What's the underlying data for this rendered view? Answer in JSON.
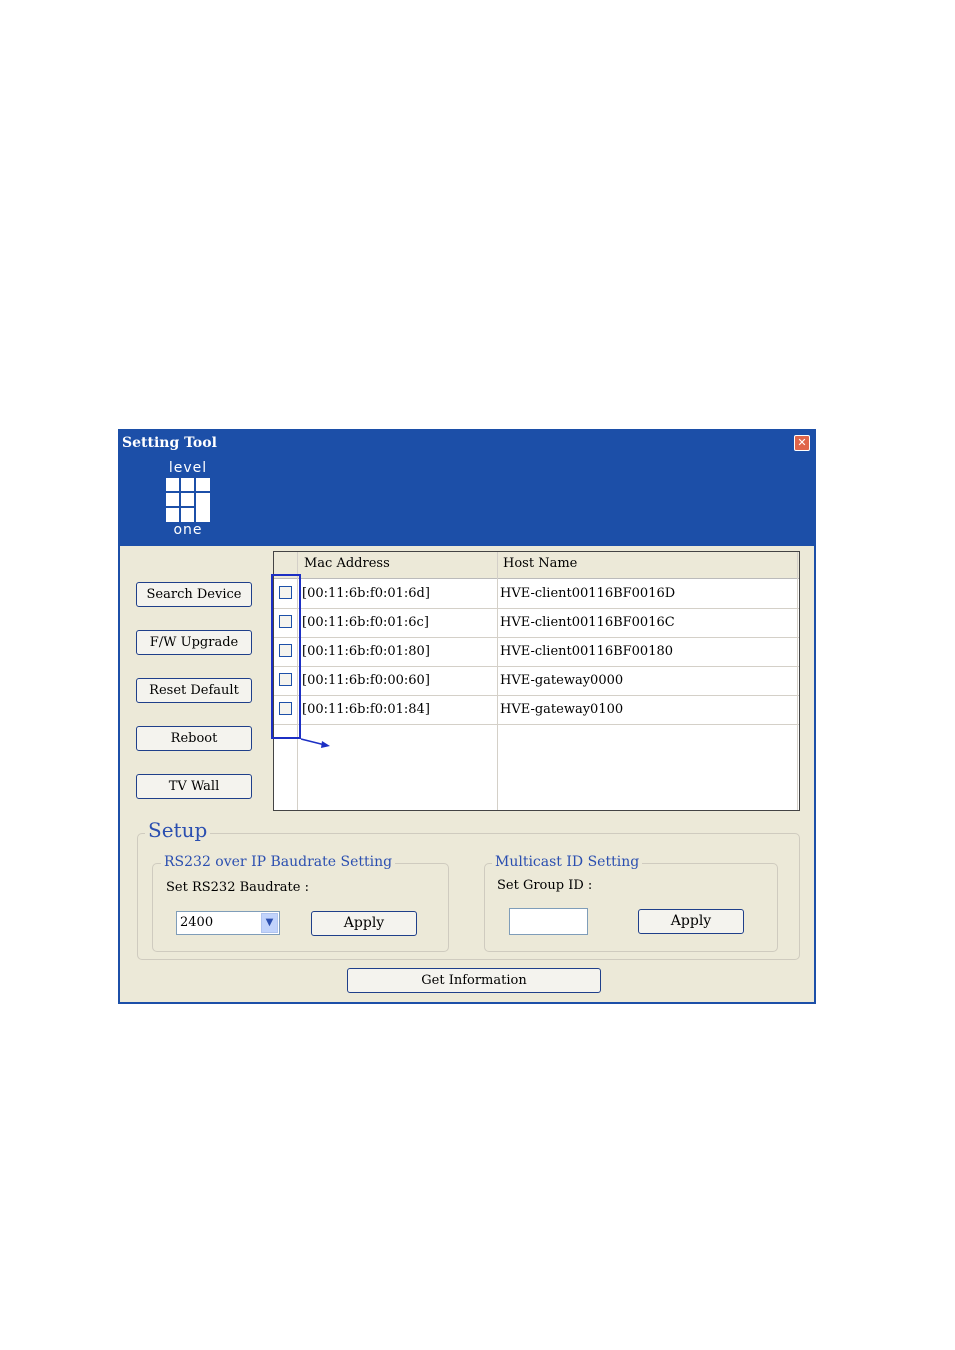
{
  "window": {
    "title": "Setting Tool",
    "close_glyph": "✕"
  },
  "logo": {
    "top_text": "level",
    "bottom_text": "one"
  },
  "buttons": {
    "search_device": "Search Device",
    "fw_upgrade": "F/W Upgrade",
    "reset_default": "Reset Default",
    "reboot": "Reboot",
    "tv_wall": "TV Wall",
    "get_information": "Get Information"
  },
  "device_list": {
    "columns": [
      "Mac Address",
      "Host Name"
    ],
    "rows": [
      {
        "mac": "[00:11:6b:f0:01:6d]",
        "host": "HVE-client00116BF0016D",
        "checked": false
      },
      {
        "mac": "[00:11:6b:f0:01:6c]",
        "host": "HVE-client00116BF0016C",
        "checked": false
      },
      {
        "mac": "[00:11:6b:f0:01:80]",
        "host": "HVE-client00116BF00180",
        "checked": false
      },
      {
        "mac": "[00:11:6b:f0:00:60]",
        "host": "HVE-gateway0000",
        "checked": false
      },
      {
        "mac": "[00:11:6b:f0:01:84]",
        "host": "HVE-gateway0100",
        "checked": false
      }
    ]
  },
  "setup": {
    "title": "Setup",
    "rs232": {
      "group_title": "RS232 over IP Baudrate Setting",
      "label": "Set RS232 Baudrate :",
      "selected": "2400",
      "apply": "Apply"
    },
    "multicast": {
      "group_title": "Multicast ID Setting",
      "label": "Set Group ID :",
      "value": "",
      "apply": "Apply"
    }
  },
  "colors": {
    "titlebar": "#1c4fa8",
    "window_bg": "#ece9d8",
    "highlight": "#1c2fc4"
  }
}
